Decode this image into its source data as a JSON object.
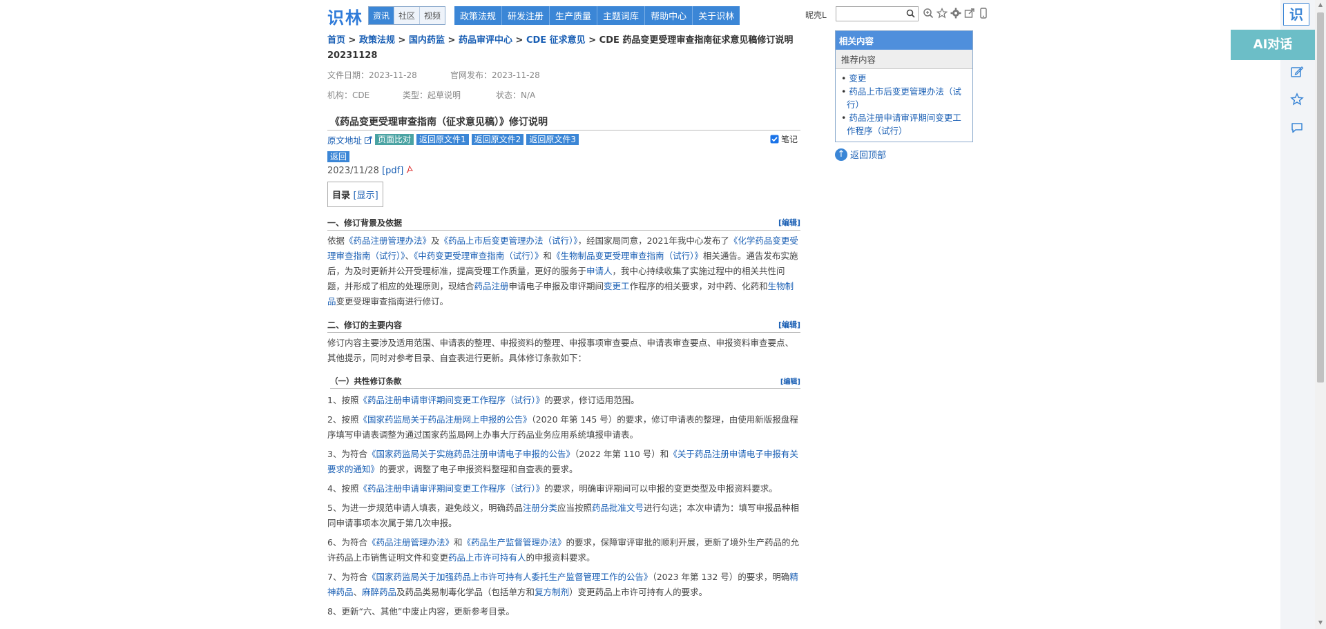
{
  "header": {
    "logo": "识林",
    "tabs_small": [
      {
        "label": "资讯",
        "active": true
      },
      {
        "label": "社区",
        "active": false
      },
      {
        "label": "视频",
        "active": false
      }
    ],
    "main_nav": [
      "政策法规",
      "研发注册",
      "生产质量",
      "主题词库",
      "帮助中心",
      "关于识林"
    ],
    "user": "昵壳L",
    "search_placeholder": ""
  },
  "breadcrumb": {
    "items": [
      "首页",
      "政策法规",
      "国内药监",
      "药品审评中心",
      "CDE 征求意见"
    ],
    "current": "CDE 药品变更受理审查指南征求意见稿修订说明 20231128",
    "sep": ">"
  },
  "meta": {
    "file_date_label": "文件日期：",
    "file_date": "2023-11-28",
    "publish_label": "官网发布：",
    "publish_date": "2023-11-28",
    "org_label": "机构：",
    "org": "CDE",
    "type_label": "类型：",
    "type": "起草说明",
    "status_label": "状态：",
    "status": "N/A"
  },
  "doc": {
    "title": "《药品变更受理审查指南（征求意见稿）》修订说明",
    "original_link": "原文地址",
    "compare_tag": "页面比对",
    "back_tags": [
      "返回原文件1",
      "返回原文件2",
      "返回原文件3"
    ],
    "notes_label": "笔记",
    "back_label": "返回",
    "date_line": "2023/11/28",
    "pdf_label": "[pdf]",
    "toc_label": "目录",
    "toc_toggle": "[显示]",
    "edit_label": "[编辑]"
  },
  "sections": {
    "s1_title": "一、修订背景及依据",
    "s1_p": {
      "t1": "依据",
      "l1": "《药品注册管理办法》",
      "t2": "及",
      "l2": "《药品上市后变更管理办法（试行）》",
      "t3": "，经国家局同意，2021年我中心发布了",
      "l3": "《化学药品变更受理审查指南（试行）》",
      "t4": "、",
      "l4": "《中药变更受理审查指南（试行）》",
      "t5": "和",
      "l5": "《生物制品变更受理审查指南（试行）》",
      "t6": "相关通告。通告发布实施后，为及时更新并公开受理标准，提高受理工作质量，更好的服务于",
      "l6": "申请人",
      "t7": "，我中心持续收集了实施过程中的相关共性问题，并形成了相应的处理原则，现结合",
      "l7": "药品注册",
      "t8": "申请电子申报及审评期间",
      "l8": "变更工",
      "t9": "作程序的相关要求，对中药、化药和",
      "l9": "生物制品",
      "t10": "变更受理审查指南进行修订。"
    },
    "s2_title": "二、修订的主要内容",
    "s2_p": "修订内容主要涉及适用范围、申请表的整理、申报资料的整理、申报事项审查要点、申请表审查要点、申报资料审查要点、其他提示，同时对参考目录、自查表进行更新。具体修订条款如下：",
    "s2a_title": "（一）共性修订条款",
    "items": {
      "i1": {
        "t1": "1、按照",
        "l1": "《药品注册申请审评期间变更工作程序（试行）》",
        "t2": "的要求，修订适用范围。"
      },
      "i2": {
        "t1": "2、按照",
        "l1": "《国家药监局关于药品注册网上申报的公告》",
        "t2": "（2020 年第 145 号）的要求，修订申请表的整理，由使用新版报盘程序填写申请表调整为通过国家药监局网上办事大厅药品业务应用系统填报申请表。"
      },
      "i3": {
        "t1": "3、为符合",
        "l1": "《国家药监局关于实施药品注册申请电子申报的公告》",
        "t2": "（2022 年第 110 号）和",
        "l2": "《关于药品注册申请电子申报有关要求的通知》",
        "t3": "的要求，调整了电子申报资料整理和自查表的要求。"
      },
      "i4": {
        "t1": "4、按照",
        "l1": "《药品注册申请审评期间变更工作程序（试行）》",
        "t2": "的要求，明确审评期间可以申报的变更类型及申报资料要求。"
      },
      "i5": {
        "t1": "5、为进一步规范申请人填表，避免歧义，明确药品",
        "l1": "注册分类",
        "t2": "应当按照",
        "l2": "药品批准文号",
        "t3": "进行勾选；本次申请为：填写申报品种相同申请事项本次属于第几次申报。"
      },
      "i6": {
        "t1": "6、为符合",
        "l1": "《药品注册管理办法》",
        "t2": "和",
        "l2": "《药品生产监督管理办法》",
        "t3": "的要求，保障审评审批的顺利开展，更新了境外生产药品的允许药品上市销售证明文件和变更",
        "l3": "药品上市许可持有人",
        "t4": "的申报资料要求。"
      },
      "i7": {
        "t1": "7、为符合",
        "l1": "《国家药监局关于加强药品上市许可持有人委托生产监督管理工作的公告》",
        "t2": "（2023 年第 132 号）的要求，明确",
        "l2": "精神药品",
        "t3": "、",
        "l3": "麻醉药品",
        "t4": "及药品类易制毒化学品（包括单方和",
        "l4": "复方制剂",
        "t5": "）变更药品上市许可持有人的要求。"
      },
      "i8": {
        "t1": "8、更新“六、其他”中废止内容，更新参考目录。"
      }
    }
  },
  "sidebar": {
    "head": "相关内容",
    "sub": "推荐内容",
    "links": [
      "变更",
      "药品上市后变更管理办法（试行）",
      "药品注册申请审评期间变更工作程序（试行）"
    ],
    "back_top": "返回顶部"
  },
  "right_rail": {
    "logo": "识",
    "ai_button": "AI对话"
  },
  "colors": {
    "accent": "#3b86d6",
    "link": "#1a5fb4",
    "ai": "#6cbec7"
  }
}
